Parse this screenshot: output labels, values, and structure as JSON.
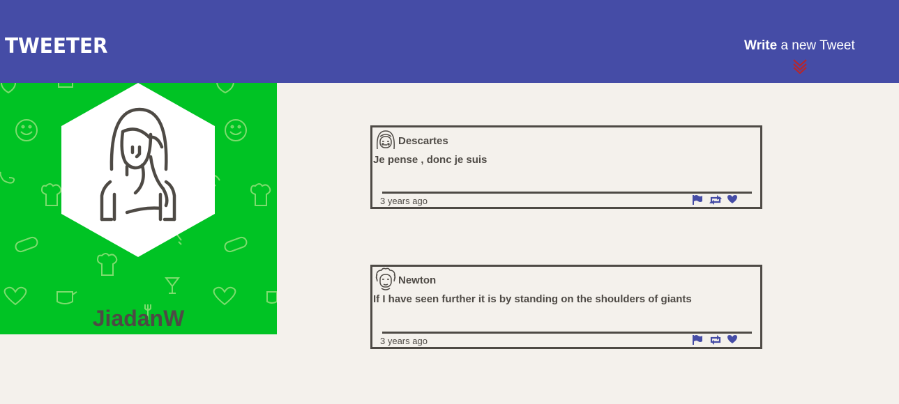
{
  "nav": {
    "brand": "TWEETER",
    "compose_bold": "Write",
    "compose_rest": " a new Tweet"
  },
  "profile": {
    "username": "JiadanW"
  },
  "tweets": [
    {
      "author": "Descartes",
      "content": "Je pense , donc je suis",
      "time": "3 years ago"
    },
    {
      "author": "Newton",
      "content": "If I have seen further it is by standing on the shoulders of giants",
      "time": "3 years ago"
    }
  ],
  "colors": {
    "nav_bg": "#454ca6",
    "profile_bg": "#00c324",
    "page_bg": "#f4f1ec",
    "text": "#4e4a45",
    "icon": "#454ca6",
    "chevron": "#b5262d"
  },
  "icons": {
    "compose_toggle": "double-chevron-down-icon",
    "flag": "flag-icon",
    "retweet": "retweet-icon",
    "like": "heart-icon"
  }
}
